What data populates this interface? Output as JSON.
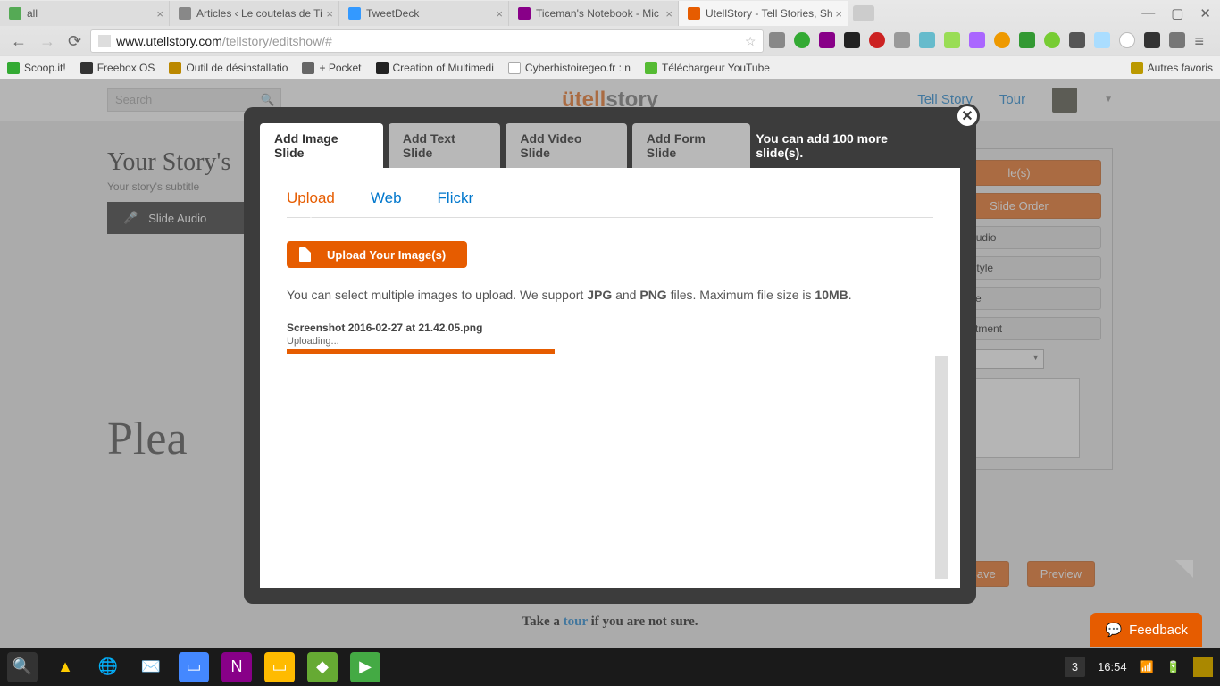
{
  "browser": {
    "tabs": [
      {
        "label": "all"
      },
      {
        "label": "Articles ‹ Le coutelas de Ti"
      },
      {
        "label": "TweetDeck"
      },
      {
        "label": "Ticeman's Notebook - Mic"
      },
      {
        "label": "UtellStory - Tell Stories, Sh"
      }
    ],
    "url_host": "www.utellstory.com",
    "url_path": "/tellstory/editshow/#",
    "bookmarks": [
      "Scoop.it!",
      "Freebox OS",
      "Outil de désinstallatio",
      "+ Pocket",
      "Creation of Multimedi",
      "Cyberhistoiregeo.fr : n",
      "Téléchargeur YouTube"
    ],
    "bm_right": "Autres favoris"
  },
  "site": {
    "search_placeholder": "Search",
    "logo_a": "ütell",
    "logo_b": "story",
    "nav_tell": "Tell Story",
    "nav_tour": "Tour"
  },
  "story": {
    "title": "Your Story's",
    "subtitle": "Your story's subtitle",
    "slide_audio": "Slide Audio",
    "placeholder_text": "Plea",
    "tour_pre": "Take a ",
    "tour_link": "tour",
    "tour_post": " if you are not sure."
  },
  "right": {
    "b1_suffix": "le(s)",
    "b2": "Slide Order",
    "b3_suffix": "und Audio",
    "b4_suffix": "und Style",
    "b5_suffix": "n Style",
    "b6_suffix": "Adjustment",
    "save": "Save",
    "preview": "Preview"
  },
  "modal": {
    "tabs": [
      "Add Image Slide",
      "Add Text Slide",
      "Add Video Slide",
      "Add Form Slide"
    ],
    "note": "You can add 100 more slide(s).",
    "subtabs": [
      "Upload",
      "Web",
      "Flickr"
    ],
    "upload_btn": "Upload Your Image(s)",
    "help_pre": "You can select multiple images to upload. We support ",
    "help_jpg": "JPG",
    "help_and": " and ",
    "help_png": "PNG",
    "help_mid": " files. Maximum file size is ",
    "help_size": "10MB",
    "help_end": ".",
    "filename": "Screenshot 2016-02-27 at 21.42.05.png",
    "uploading": "Uploading..."
  },
  "feedback": "Feedback",
  "taskbar": {
    "badge": "3",
    "clock": "16:54"
  }
}
